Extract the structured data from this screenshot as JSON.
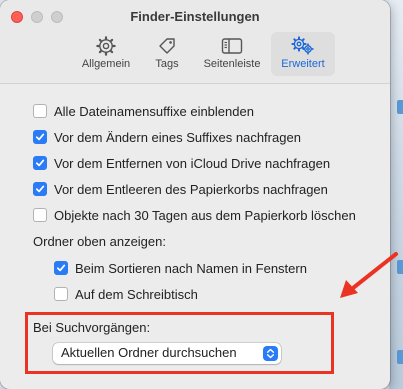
{
  "window": {
    "title": "Finder-Einstellungen"
  },
  "toolbar": {
    "tabs": [
      {
        "label": "Allgemein",
        "icon": "gear-icon"
      },
      {
        "label": "Tags",
        "icon": "tag-icon"
      },
      {
        "label": "Seitenleiste",
        "icon": "sidebar-icon"
      },
      {
        "label": "Erweitert",
        "icon": "gears-icon",
        "active": true
      }
    ]
  },
  "options": {
    "items": [
      {
        "label": "Alle Dateinamensuffixe einblenden",
        "checked": false
      },
      {
        "label": "Vor dem Ändern eines Suffixes nachfragen",
        "checked": true
      },
      {
        "label": "Vor dem Entfernen von iCloud Drive nachfragen",
        "checked": true
      },
      {
        "label": "Vor dem Entleeren des Papierkorbs nachfragen",
        "checked": true
      },
      {
        "label": "Objekte nach 30 Tagen aus dem Papierkorb löschen",
        "checked": false
      }
    ]
  },
  "folders_on_top": {
    "heading": "Ordner oben anzeigen:",
    "items": [
      {
        "label": "Beim Sortieren nach Namen in Fenstern",
        "checked": true
      },
      {
        "label": "Auf dem Schreibtisch",
        "checked": false
      }
    ]
  },
  "search": {
    "heading": "Bei Suchvorgängen:",
    "selected": "Aktuellen Ordner durchsuchen"
  },
  "colors": {
    "accent": "#2a7cf6",
    "annotation": "#ea3323"
  }
}
